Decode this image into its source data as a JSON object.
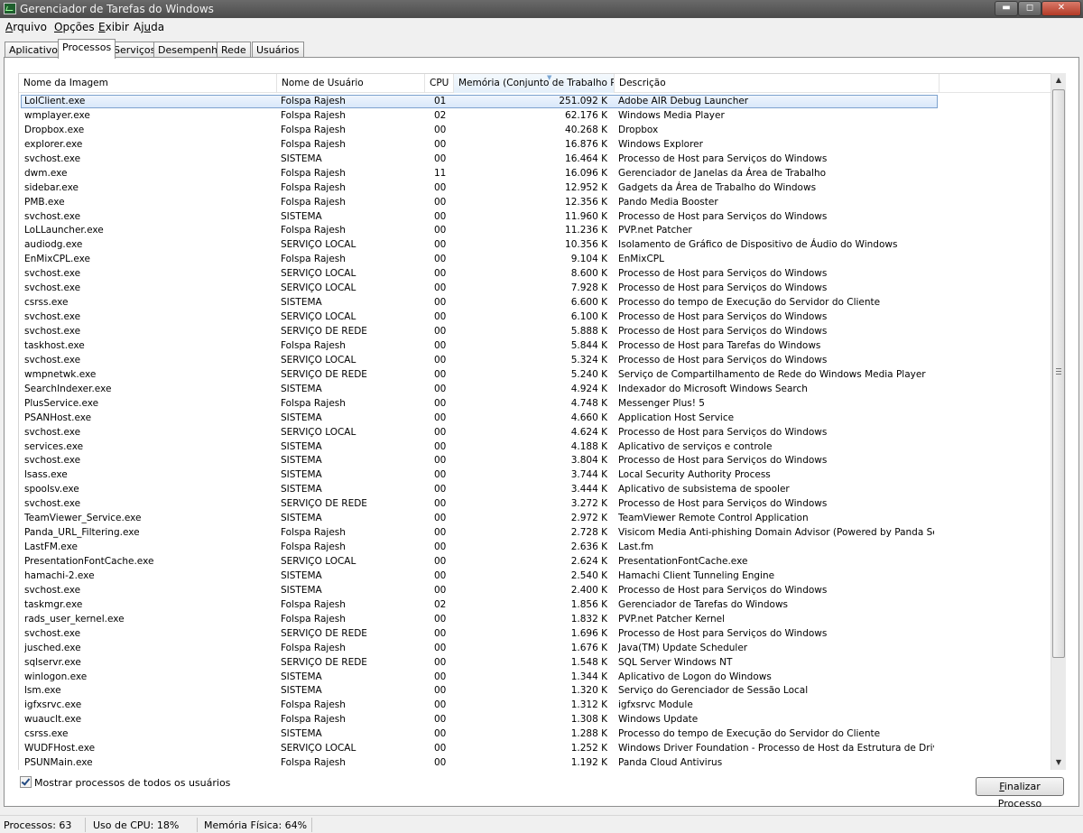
{
  "window": {
    "title": "Gerenciador de Tarefas do Windows"
  },
  "window_buttons": {
    "minimize": "▬",
    "maximize": "◻",
    "close": "✕"
  },
  "menu": [
    {
      "ul": "A",
      "rest": "rquivo"
    },
    {
      "ul": "O",
      "rest": "pções"
    },
    {
      "ul": "E",
      "rest": "xibir"
    },
    {
      "pre": "Aj",
      "ul": "u",
      "rest": "da"
    }
  ],
  "tabs": [
    "Aplicativos",
    "Processos",
    "Serviços",
    "Desempenho",
    "Rede",
    "Usuários"
  ],
  "active_tab": "Processos",
  "columns": {
    "name": "Nome da Imagem",
    "user": "Nome de Usuário",
    "cpu": "CPU",
    "memory": "Memória (Conjunto de Trabalho Pa...",
    "description": "Descrição"
  },
  "processes": [
    [
      "LolClient.exe",
      "Folspa Rajesh",
      "01",
      "251.092 K",
      "Adobe AIR Debug Launcher"
    ],
    [
      "wmplayer.exe",
      "Folspa Rajesh",
      "02",
      "62.176 K",
      "Windows Media Player"
    ],
    [
      "Dropbox.exe",
      "Folspa Rajesh",
      "00",
      "40.268 K",
      "Dropbox"
    ],
    [
      "explorer.exe",
      "Folspa Rajesh",
      "00",
      "16.876 K",
      "Windows Explorer"
    ],
    [
      "svchost.exe",
      "SISTEMA",
      "00",
      "16.464 K",
      "Processo de Host para Serviços do Windows"
    ],
    [
      "dwm.exe",
      "Folspa Rajesh",
      "11",
      "16.096 K",
      "Gerenciador de Janelas da Área de Trabalho"
    ],
    [
      "sidebar.exe",
      "Folspa Rajesh",
      "00",
      "12.952 K",
      "Gadgets da Área de Trabalho do Windows"
    ],
    [
      "PMB.exe",
      "Folspa Rajesh",
      "00",
      "12.356 K",
      "Pando Media Booster"
    ],
    [
      "svchost.exe",
      "SISTEMA",
      "00",
      "11.960 K",
      "Processo de Host para Serviços do Windows"
    ],
    [
      "LoLLauncher.exe",
      "Folspa Rajesh",
      "00",
      "11.236 K",
      "PVP.net Patcher"
    ],
    [
      "audiodg.exe",
      "SERVIÇO LOCAL",
      "00",
      "10.356 K",
      "Isolamento de Gráfico de Dispositivo de Áudio do Windows"
    ],
    [
      "EnMixCPL.exe",
      "Folspa Rajesh",
      "00",
      "9.104 K",
      "EnMixCPL"
    ],
    [
      "svchost.exe",
      "SERVIÇO LOCAL",
      "00",
      "8.600 K",
      "Processo de Host para Serviços do Windows"
    ],
    [
      "svchost.exe",
      "SERVIÇO LOCAL",
      "00",
      "7.928 K",
      "Processo de Host para Serviços do Windows"
    ],
    [
      "csrss.exe",
      "SISTEMA",
      "00",
      "6.600 K",
      "Processo do tempo de Execução do Servidor do Cliente"
    ],
    [
      "svchost.exe",
      "SERVIÇO LOCAL",
      "00",
      "6.100 K",
      "Processo de Host para Serviços do Windows"
    ],
    [
      "svchost.exe",
      "SERVIÇO DE REDE",
      "00",
      "5.888 K",
      "Processo de Host para Serviços do Windows"
    ],
    [
      "taskhost.exe",
      "Folspa Rajesh",
      "00",
      "5.844 K",
      "Processo de Host para Tarefas do Windows"
    ],
    [
      "svchost.exe",
      "SERVIÇO LOCAL",
      "00",
      "5.324 K",
      "Processo de Host para Serviços do Windows"
    ],
    [
      "wmpnetwk.exe",
      "SERVIÇO DE REDE",
      "00",
      "5.240 K",
      "Serviço de Compartilhamento de Rede do Windows Media Player"
    ],
    [
      "SearchIndexer.exe",
      "SISTEMA",
      "00",
      "4.924 K",
      "Indexador do Microsoft Windows Search"
    ],
    [
      "PlusService.exe",
      "Folspa Rajesh",
      "00",
      "4.748 K",
      "Messenger Plus! 5"
    ],
    [
      "PSANHost.exe",
      "SISTEMA",
      "00",
      "4.660 K",
      "Application Host Service"
    ],
    [
      "svchost.exe",
      "SERVIÇO LOCAL",
      "00",
      "4.624 K",
      "Processo de Host para Serviços do Windows"
    ],
    [
      "services.exe",
      "SISTEMA",
      "00",
      "4.188 K",
      "Aplicativo de serviços e controle"
    ],
    [
      "svchost.exe",
      "SISTEMA",
      "00",
      "3.804 K",
      "Processo de Host para Serviços do Windows"
    ],
    [
      "lsass.exe",
      "SISTEMA",
      "00",
      "3.744 K",
      "Local Security Authority Process"
    ],
    [
      "spoolsv.exe",
      "SISTEMA",
      "00",
      "3.444 K",
      "Aplicativo de subsistema de spooler"
    ],
    [
      "svchost.exe",
      "SERVIÇO DE REDE",
      "00",
      "3.272 K",
      "Processo de Host para Serviços do Windows"
    ],
    [
      "TeamViewer_Service.exe",
      "SISTEMA",
      "00",
      "2.972 K",
      "TeamViewer Remote Control Application"
    ],
    [
      "Panda_URL_Filtering.exe",
      "Folspa Rajesh",
      "00",
      "2.728 K",
      "Visicom Media Anti-phishing Domain Advisor (Powered by Panda Security)"
    ],
    [
      "LastFM.exe",
      "Folspa Rajesh",
      "00",
      "2.636 K",
      "Last.fm"
    ],
    [
      "PresentationFontCache.exe",
      "SERVIÇO LOCAL",
      "00",
      "2.624 K",
      "PresentationFontCache.exe"
    ],
    [
      "hamachi-2.exe",
      "SISTEMA",
      "00",
      "2.540 K",
      "Hamachi Client Tunneling Engine"
    ],
    [
      "svchost.exe",
      "SISTEMA",
      "00",
      "2.400 K",
      "Processo de Host para Serviços do Windows"
    ],
    [
      "taskmgr.exe",
      "Folspa Rajesh",
      "02",
      "1.856 K",
      "Gerenciador de Tarefas do Windows"
    ],
    [
      "rads_user_kernel.exe",
      "Folspa Rajesh",
      "00",
      "1.832 K",
      "PVP.net Patcher Kernel"
    ],
    [
      "svchost.exe",
      "SERVIÇO DE REDE",
      "00",
      "1.696 K",
      "Processo de Host para Serviços do Windows"
    ],
    [
      "jusched.exe",
      "Folspa Rajesh",
      "00",
      "1.676 K",
      "Java(TM) Update Scheduler"
    ],
    [
      "sqlservr.exe",
      "SERVIÇO DE REDE",
      "00",
      "1.548 K",
      "SQL Server Windows NT"
    ],
    [
      "winlogon.exe",
      "SISTEMA",
      "00",
      "1.344 K",
      "Aplicativo de Logon do Windows"
    ],
    [
      "lsm.exe",
      "SISTEMA",
      "00",
      "1.320 K",
      "Serviço do Gerenciador de Sessão Local"
    ],
    [
      "igfxsrvc.exe",
      "Folspa Rajesh",
      "00",
      "1.312 K",
      "igfxsrvc Module"
    ],
    [
      "wuauclt.exe",
      "Folspa Rajesh",
      "00",
      "1.308 K",
      "Windows Update"
    ],
    [
      "csrss.exe",
      "SISTEMA",
      "00",
      "1.288 K",
      "Processo do tempo de Execução do Servidor do Cliente"
    ],
    [
      "WUDFHost.exe",
      "SERVIÇO LOCAL",
      "00",
      "1.252 K",
      "Windows Driver Foundation - Processo de Host da Estrutura de Driver de ..."
    ],
    [
      "PSUNMain.exe",
      "Folspa Rajesh",
      "00",
      "1.192 K",
      "Panda Cloud Antivirus"
    ]
  ],
  "selected_row": 0,
  "show_all_users": {
    "label": "Mostrar processos de todos os usuários",
    "checked": true
  },
  "end_process_button": {
    "ul": "F",
    "rest": "inalizar Processo"
  },
  "status": {
    "processes": "Processos: 63",
    "cpu": "Uso de CPU: 18%",
    "memory": "Memória Física: 64%"
  },
  "scrollbar": {
    "up": "▲",
    "down": "▼"
  }
}
